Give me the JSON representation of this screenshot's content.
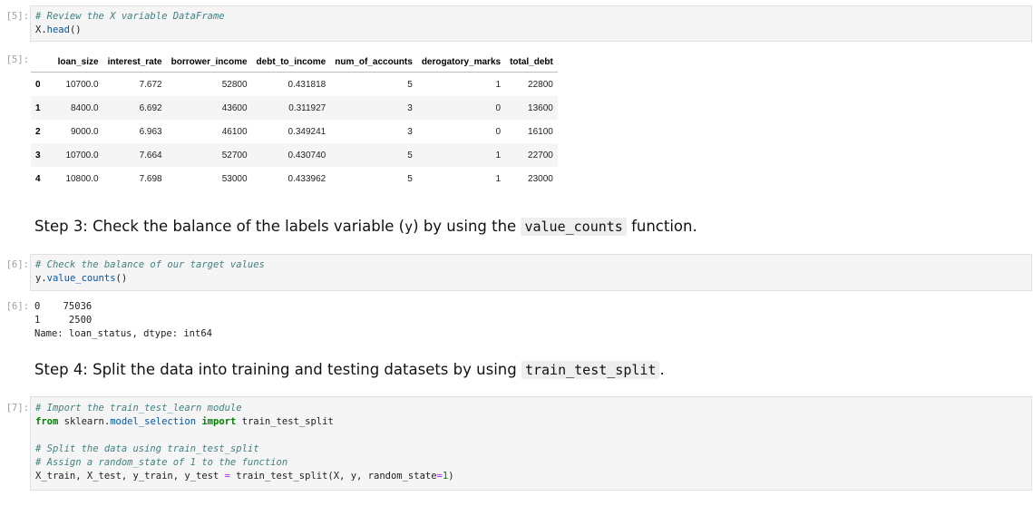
{
  "cell5": {
    "in_prompt": "[5]:",
    "comment": "# Review the X variable DataFrame",
    "code_obj": "X.",
    "code_fn": "head",
    "code_tail": "()",
    "out_prompt": "[5]:",
    "table": {
      "columns": [
        "",
        "loan_size",
        "interest_rate",
        "borrower_income",
        "debt_to_income",
        "num_of_accounts",
        "derogatory_marks",
        "total_debt"
      ],
      "rows": [
        [
          "0",
          "10700.0",
          "7.672",
          "52800",
          "0.431818",
          "5",
          "1",
          "22800"
        ],
        [
          "1",
          "8400.0",
          "6.692",
          "43600",
          "0.311927",
          "3",
          "0",
          "13600"
        ],
        [
          "2",
          "9000.0",
          "6.963",
          "46100",
          "0.349241",
          "3",
          "0",
          "16100"
        ],
        [
          "3",
          "10700.0",
          "7.664",
          "52700",
          "0.430740",
          "5",
          "1",
          "22700"
        ],
        [
          "4",
          "10800.0",
          "7.698",
          "53000",
          "0.433962",
          "5",
          "1",
          "23000"
        ]
      ]
    }
  },
  "step3": {
    "prefix": "Step 3: Check the balance of the labels variable (",
    "var": "y",
    "middle": ") by using the",
    "code": "value_counts",
    "suffix": "function."
  },
  "cell6": {
    "in_prompt": "[6]:",
    "comment": "# Check the balance of our target values",
    "code_obj": "y.",
    "code_fn": "value_counts",
    "code_tail": "()",
    "out_prompt": "[6]:",
    "output_lines": [
      "0    75036",
      "1     2500",
      "Name: loan_status, dtype: int64"
    ]
  },
  "step4": {
    "prefix": "Step 4: Split the data into training and testing datasets by using",
    "code": "train_test_split",
    "suffix": "."
  },
  "cell7": {
    "in_prompt": "[7]:",
    "comment1": "# Import the train_test_learn module",
    "kw_from": "from",
    "module_pre": " sklearn.",
    "module_fn": "model_selection",
    "kw_import": "import",
    "import_name": " train_test_split",
    "comment2": "# Split the data using train_test_split",
    "comment3": "# Assign a random_state of 1 to the function",
    "line_pre": "X_train, X_test, y_train, y_test ",
    "line_eq": "=",
    "line_call": " train_test_split(X, y, random_state",
    "line_eq2": "=",
    "line_num": "1",
    "line_end": ")"
  }
}
